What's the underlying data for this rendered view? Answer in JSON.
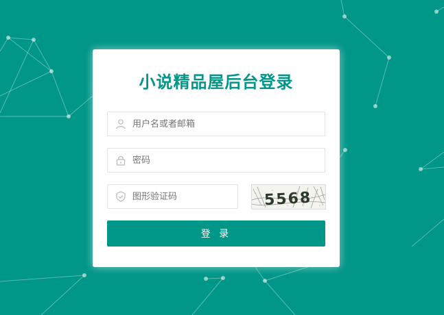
{
  "login": {
    "title": "小说精品屋后台登录",
    "username_placeholder": "用户名或者邮箱",
    "password_placeholder": "密码",
    "captcha_placeholder": "图形验证码",
    "captcha_code": "5568",
    "submit_label": "登 录"
  },
  "colors": {
    "background": "#009688",
    "accent": "#009688",
    "card": "#ffffff"
  },
  "icons": {
    "username": "user-icon",
    "password": "lock-icon",
    "captcha": "shield-icon"
  }
}
